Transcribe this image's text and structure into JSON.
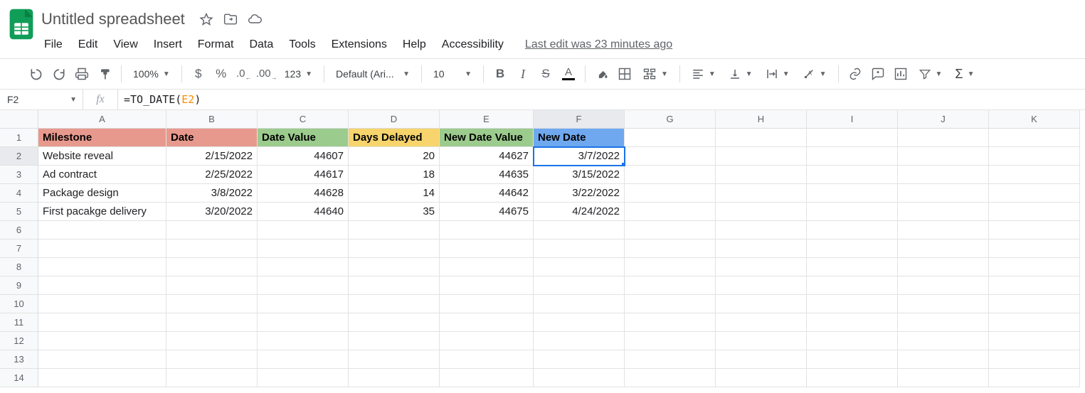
{
  "doc": {
    "title": "Untitled spreadsheet"
  },
  "menu": {
    "file": "File",
    "edit": "Edit",
    "view": "View",
    "insert": "Insert",
    "format": "Format",
    "data": "Data",
    "tools": "Tools",
    "extensions": "Extensions",
    "help": "Help",
    "accessibility": "Accessibility",
    "last_edit": "Last edit was 23 minutes ago"
  },
  "toolbar": {
    "zoom": "100%",
    "currency_symbol": "$",
    "pct_symbol": "%",
    "dec_dec": ".0",
    "inc_dec": ".00",
    "num_format": "123",
    "font": "Default (Ari...",
    "font_size": "10",
    "text_color_letter": "A"
  },
  "fx": {
    "name_box": "F2",
    "label": "fx",
    "formula_prefix": "=TO_DATE(",
    "formula_ref": "E2",
    "formula_suffix": ")"
  },
  "columns": [
    "A",
    "B",
    "C",
    "D",
    "E",
    "F",
    "G",
    "H",
    "I",
    "J",
    "K"
  ],
  "row_numbers": [
    "1",
    "2",
    "3",
    "4",
    "5",
    "6",
    "7",
    "8",
    "9",
    "10",
    "11",
    "12",
    "13",
    "14"
  ],
  "headers": {
    "A": "Milestone",
    "B": "Date",
    "C": "Date Value",
    "D": "Days Delayed",
    "E": "New Date Value",
    "F": "New Date"
  },
  "data": [
    {
      "milestone": "Website reveal",
      "date": "2/15/2022",
      "date_value": "44607",
      "delay": "20",
      "new_value": "44627",
      "new_date": "3/7/2022"
    },
    {
      "milestone": "Ad contract",
      "date": "2/25/2022",
      "date_value": "44617",
      "delay": "18",
      "new_value": "44635",
      "new_date": "3/15/2022"
    },
    {
      "milestone": "Package design",
      "date": "3/8/2022",
      "date_value": "44628",
      "delay": "14",
      "new_value": "44642",
      "new_date": "3/22/2022"
    },
    {
      "milestone": "First pacakge delivery",
      "date": "3/20/2022",
      "date_value": "44640",
      "delay": "35",
      "new_value": "44675",
      "new_date": "4/24/2022"
    }
  ],
  "active_cell": "F2"
}
